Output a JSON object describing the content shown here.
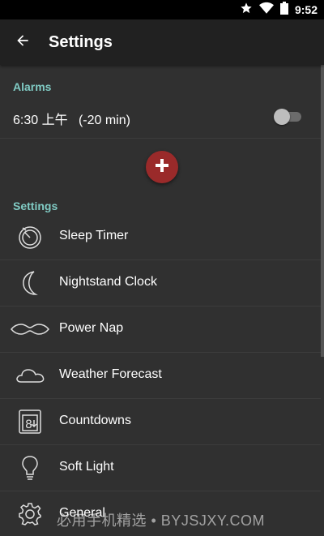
{
  "status_bar": {
    "time": "9:52",
    "icons": [
      "star-icon",
      "wifi-icon",
      "battery-icon"
    ]
  },
  "app_bar": {
    "title": "Settings",
    "back_icon": "arrow-back-icon"
  },
  "alarms": {
    "header": "Alarms",
    "items": [
      {
        "time": "6:30 上午",
        "offset": "(-20 min)",
        "enabled": false
      }
    ],
    "add_icon": "plus-icon"
  },
  "settings": {
    "header": "Settings",
    "items": [
      {
        "label": "Sleep Timer",
        "icon": "sleep-timer-icon"
      },
      {
        "label": "Nightstand Clock",
        "icon": "moon-icon"
      },
      {
        "label": "Power Nap",
        "icon": "sleep-mask-icon"
      },
      {
        "label": "Weather Forecast",
        "icon": "cloud-icon"
      },
      {
        "label": "Countdowns",
        "icon": "countdown-icon"
      },
      {
        "label": "Soft Light",
        "icon": "lightbulb-icon"
      },
      {
        "label": "General",
        "icon": "gear-icon"
      }
    ]
  },
  "watermark": "必用手机精选 • BYJSJXY.COM",
  "colors": {
    "background": "#303030",
    "app_bar": "#212121",
    "accent": "#80cbc4",
    "fab": "#9a2a2a"
  }
}
